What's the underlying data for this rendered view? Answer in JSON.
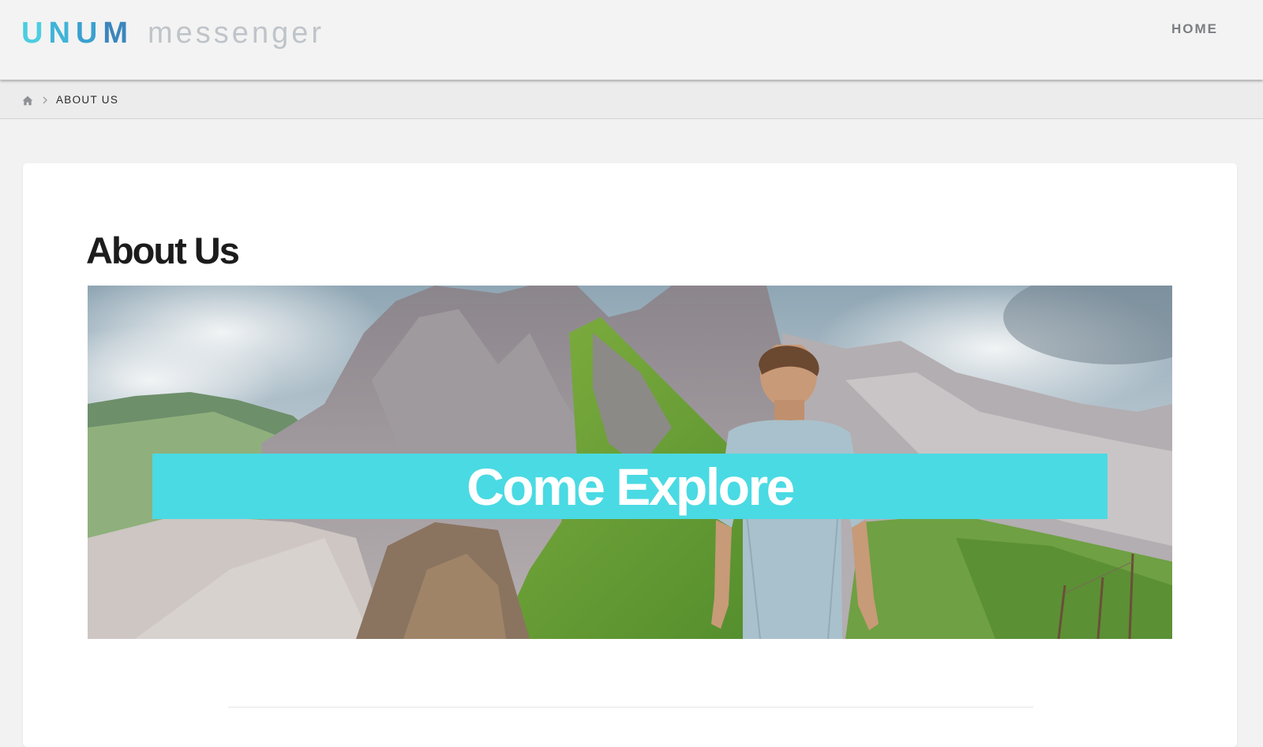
{
  "header": {
    "brand": {
      "name_letters": [
        "U",
        "N",
        "U",
        "M"
      ],
      "tagline": "messenger"
    },
    "nav": [
      {
        "label": "HOME"
      }
    ]
  },
  "breadcrumb": {
    "home_icon": "home-icon",
    "separator_icon": "chevron-right-icon",
    "current": "ABOUT US"
  },
  "page": {
    "title": "About Us",
    "hero": {
      "banner_text": "Come Explore",
      "image_subject": "mountain-landscape-with-hiker"
    }
  },
  "colors": {
    "brand_letters": [
      "#4dcde0",
      "#3fb4d8",
      "#3aa0d0",
      "#3a86bd"
    ],
    "tagline": "#bfc4c9",
    "nav_text": "#7b7f84",
    "banner_bg": "#4adae3",
    "title_text": "#1c1c1c"
  }
}
